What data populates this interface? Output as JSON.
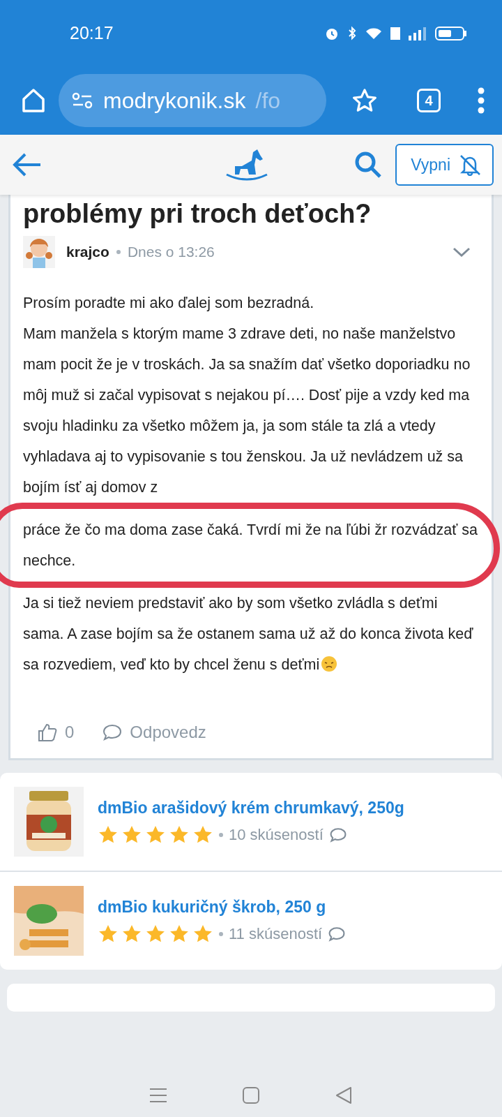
{
  "status_bar": {
    "time": "20:17"
  },
  "browser": {
    "url_host": "modrykonik.sk",
    "url_rest": "/fo",
    "tab_count": "4"
  },
  "site_header": {
    "mute_button": "Vypni"
  },
  "post": {
    "title": "problémy pri troch deťoch?",
    "author": "krajco",
    "time": "Dnes o 13:26",
    "paragraphs": [
      {
        "text": "Prosím poradte mi ako ďalej som bezradná.",
        "circled": false
      },
      {
        "text": "Mam manžela s ktorým mame 3 zdrave deti, no naše manželstvo mam pocit že je v troskách. Ja sa snažím dať všetko doporiadku no môj muž si začal vypisovat s nejakou pí…. Dosť pije a vzdy ked ma svoju hladinku za všetko môžem ja, ja som stále ta zlá a vtedy vyhladava aj to vypisovanie s tou ženskou. Ja už nevládzem už sa bojím ísť aj domov z",
        "circled": false
      },
      {
        "text": "práce že čo ma doma zase čaká. Tvrdí mi že na ľúbi žr rozvádzať sa nechce.",
        "circled": true
      },
      {
        "text": "Ja si tiež neviem predstaviť ako by som všetko zvládla s deťmi sama. A zase bojím sa že ostanem sama už až do konca života keď sa rozvediem, veď kto by chcel ženu s deťmi",
        "circled": false
      }
    ],
    "likes": "0",
    "reply": "Odpovedz"
  },
  "products": [
    {
      "name": "dmBio arašidový krém chrumkavý, 250g",
      "stars": 5,
      "reviews": "10 skúseností",
      "kind": "jar"
    },
    {
      "name": "dmBio kukuričný škrob, 250 g",
      "stars": 5,
      "reviews": "11 skúseností",
      "kind": "box"
    }
  ]
}
